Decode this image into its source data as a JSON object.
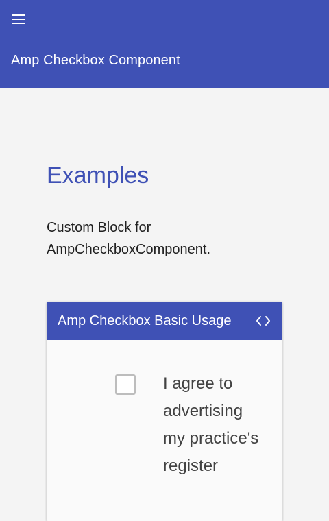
{
  "toolbar": {
    "menu_icon": "menu-icon",
    "title": "Amp Checkbox Component",
    "background_color": "#3f51b5"
  },
  "main": {
    "heading": "Examples",
    "intro": "Custom Block for AmpCheckboxComponent.",
    "accent_color": "#3f51b5",
    "example": {
      "title": "Amp Checkbox Basic Usage",
      "code_icon": "code-icon",
      "checkbox": {
        "checked": false,
        "label": "I agree to advertising my practice's register"
      }
    }
  }
}
